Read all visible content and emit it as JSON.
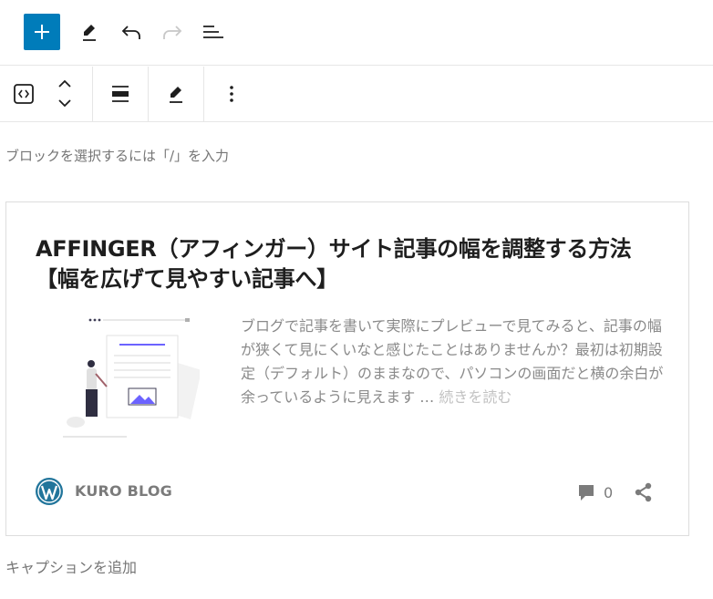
{
  "editor": {
    "block_placeholder": "ブロックを選択するには「/」を入力",
    "caption_placeholder": "キャプションを追加"
  },
  "colors": {
    "accent": "#007cba",
    "wp_logo": "#21759b",
    "thumb_accent": "#6c63ff"
  },
  "top_toolbar": {
    "icons": [
      "plus-icon",
      "pencil-icon",
      "undo-icon",
      "redo-icon",
      "list-view-icon"
    ]
  },
  "block_toolbar": {
    "icons": [
      "embed-icon",
      "move-up-icon",
      "move-down-icon",
      "align-icon",
      "edit-icon",
      "more-options-icon"
    ]
  },
  "card": {
    "title": "AFFINGER（アフィンガー）サイト記事の幅を調整する方法【幅を広げて見やすい記事へ】",
    "excerpt": "ブログで記事を書いて実際にプレビューで見てみると、記事の幅が狭くて見にくいなと感じたことはありませんか？最初は初期設定（デフォルト）のままなので、パソコンの画面だと横の余白が余っているように見えます … ",
    "read_more": "続きを読む",
    "site_name": "KURO BLOG",
    "comment_count": "0"
  }
}
